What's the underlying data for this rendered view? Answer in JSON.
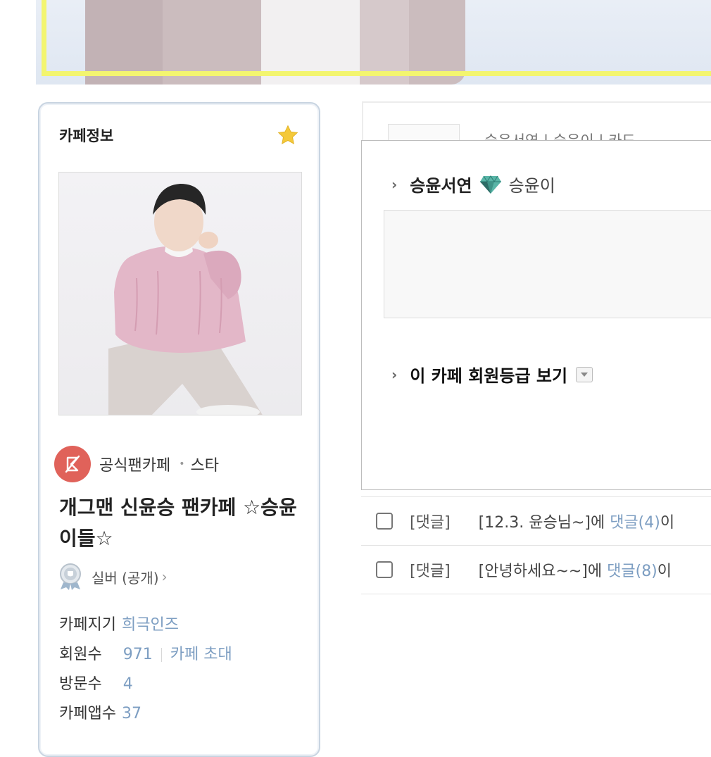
{
  "info": {
    "title": "카페정보",
    "official_label": "공식팬카페",
    "official_sep": "•",
    "category": "스타",
    "cafe_name": "개그맨 신윤승 팬카페 ☆승윤이들☆",
    "grade": "실버 (공개)",
    "grade_chevron": "›",
    "stats": {
      "manager_label": "카페지기",
      "manager_value": "희극인즈",
      "members_label": "회원수",
      "members_value": "971",
      "invite_link": "카페 초대",
      "visits_label": "방문수",
      "visits_value": "4",
      "apps_label": "카페앱수",
      "apps_value": "37"
    }
  },
  "popup": {
    "chevron": "›",
    "member_name": "승윤서연",
    "member_grade": "승윤이",
    "grade_view_label": "이 카페 회원등급 보기",
    "hidden_header": "승윤서연 | 승윤이 | 카드"
  },
  "notices": [
    {
      "tag": "[댓글]",
      "prefix": "[12.3. 윤승님~]에 ",
      "link": "댓글(4)",
      "suffix": "이"
    },
    {
      "tag": "[댓글]",
      "prefix": "[안녕하세요~~]에 ",
      "link": "댓글(8)",
      "suffix": "이"
    }
  ],
  "colors": {
    "accent_link": "#7d9ec2",
    "official_badge": "#e0625a",
    "banner_frame": "#f3f56f",
    "star": "#f4c93a"
  }
}
